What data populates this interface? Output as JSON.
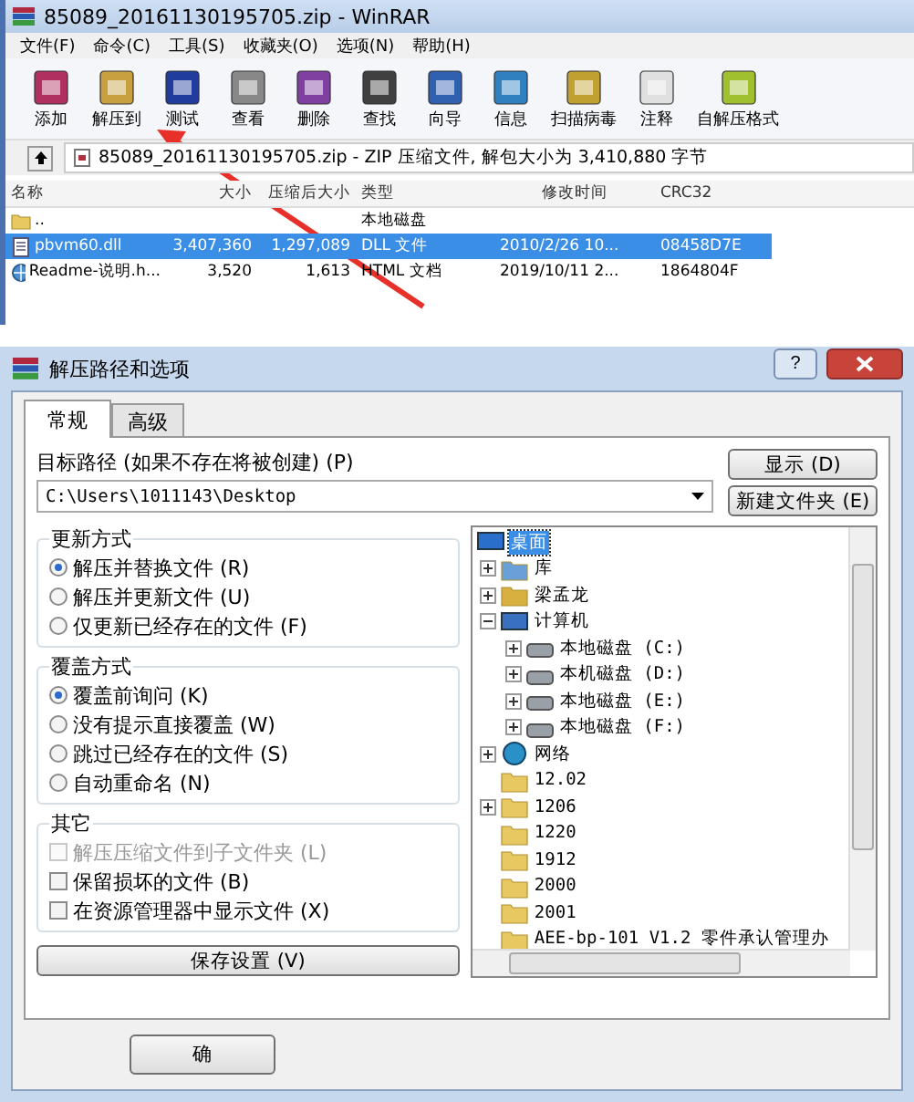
{
  "winrar": {
    "title": "85089_20161130195705.zip - WinRAR",
    "menu": [
      "文件(F)",
      "命令(C)",
      "工具(S)",
      "收藏夹(O)",
      "选项(N)",
      "帮助(H)"
    ],
    "toolbar": [
      {
        "label": "添加"
      },
      {
        "label": "解压到"
      },
      {
        "label": "测试"
      },
      {
        "label": "查看"
      },
      {
        "label": "删除"
      },
      {
        "label": "查找"
      },
      {
        "label": "向导"
      },
      {
        "label": "信息"
      },
      {
        "label": "扫描病毒"
      },
      {
        "label": "注释"
      },
      {
        "label": "自解压格式"
      }
    ],
    "address": "85089_20161130195705.zip - ZIP 压缩文件, 解包大小为 3,410,880 字节",
    "columns": [
      "名称",
      "大小",
      "压缩后大小",
      "类型",
      "修改时间",
      "CRC32"
    ],
    "rows": [
      {
        "kind": "folder",
        "name": "..",
        "type": "本地磁盘",
        "selected": false
      },
      {
        "kind": "dll",
        "name": "pbvm60.dll",
        "size": "3,407,360",
        "packed": "1,297,089",
        "type": "DLL 文件",
        "modified": "2010/2/26 10...",
        "crc": "08458D7E",
        "selected": true
      },
      {
        "kind": "html",
        "name": "Readme-说明.h...",
        "size": "3,520",
        "packed": "1,613",
        "type": "HTML 文档",
        "modified": "2019/10/11 2...",
        "crc": "1864804F",
        "selected": false
      }
    ]
  },
  "dialog": {
    "title": "解压路径和选项",
    "help": "?",
    "tabs": [
      {
        "label": "常规",
        "selected": true
      },
      {
        "label": "高级",
        "selected": false
      }
    ],
    "path_label": "目标路径 (如果不存在将被创建) (P)",
    "path_value": "C:\\Users\\1011143\\Desktop",
    "side_buttons": [
      "显示 (D)",
      "新建文件夹 (E)"
    ],
    "groups": [
      {
        "title": "更新方式",
        "options": [
          {
            "kind": "radio",
            "label": "解压并替换文件 (R)",
            "checked": true,
            "disabled": false
          },
          {
            "kind": "radio",
            "label": "解压并更新文件 (U)",
            "checked": false,
            "disabled": false
          },
          {
            "kind": "radio",
            "label": "仅更新已经存在的文件 (F)",
            "checked": false,
            "disabled": false
          }
        ]
      },
      {
        "title": "覆盖方式",
        "options": [
          {
            "kind": "radio",
            "label": "覆盖前询问 (K)",
            "checked": true,
            "disabled": false
          },
          {
            "kind": "radio",
            "label": "没有提示直接覆盖 (W)",
            "checked": false,
            "disabled": false
          },
          {
            "kind": "radio",
            "label": "跳过已经存在的文件 (S)",
            "checked": false,
            "disabled": false
          },
          {
            "kind": "radio",
            "label": "自动重命名 (N)",
            "checked": false,
            "disabled": false
          }
        ]
      },
      {
        "title": "其它",
        "options": [
          {
            "kind": "checkbox",
            "label": "解压压缩文件到子文件夹 (L)",
            "checked": false,
            "disabled": true
          },
          {
            "kind": "checkbox",
            "label": "保留损坏的文件 (B)",
            "checked": false,
            "disabled": false
          },
          {
            "kind": "checkbox",
            "label": "在资源管理器中显示文件 (X)",
            "checked": false,
            "disabled": false
          }
        ]
      }
    ],
    "save_button": "保存设置 (V)",
    "tree": [
      {
        "kind": "desktop",
        "label": "桌面",
        "selected": true,
        "children": [
          {
            "kind": "library",
            "label": "库",
            "expanded": false,
            "selected": false
          },
          {
            "kind": "user",
            "label": "梁孟龙",
            "expanded": false,
            "selected": false
          },
          {
            "kind": "computer",
            "label": "计算机",
            "expanded": true,
            "selected": false,
            "children": [
              {
                "kind": "drive",
                "label": "本地磁盘 (C:)",
                "expanded": false,
                "selected": false
              },
              {
                "kind": "drive",
                "label": "本机磁盘 (D:)",
                "expanded": false,
                "selected": false
              },
              {
                "kind": "drive",
                "label": "本地磁盘 (E:)",
                "expanded": false,
                "selected": false
              },
              {
                "kind": "drive",
                "label": "本地磁盘 (F:)",
                "expanded": false,
                "selected": false
              }
            ]
          },
          {
            "kind": "network",
            "label": "网络",
            "expanded": false,
            "selected": false
          },
          {
            "kind": "folder",
            "label": "12.02",
            "selected": false
          },
          {
            "kind": "folder",
            "label": "1206",
            "expanded": false,
            "selected": false
          },
          {
            "kind": "folder",
            "label": "1220",
            "selected": false
          },
          {
            "kind": "folder",
            "label": "1912",
            "selected": false
          },
          {
            "kind": "folder",
            "label": "2000",
            "selected": false
          },
          {
            "kind": "folder",
            "label": "2001",
            "selected": false
          },
          {
            "kind": "folder",
            "label": "AEE-bp-101 V1.2 零件承认管理办",
            "selected": false
          }
        ]
      }
    ],
    "ok_button": "确"
  }
}
